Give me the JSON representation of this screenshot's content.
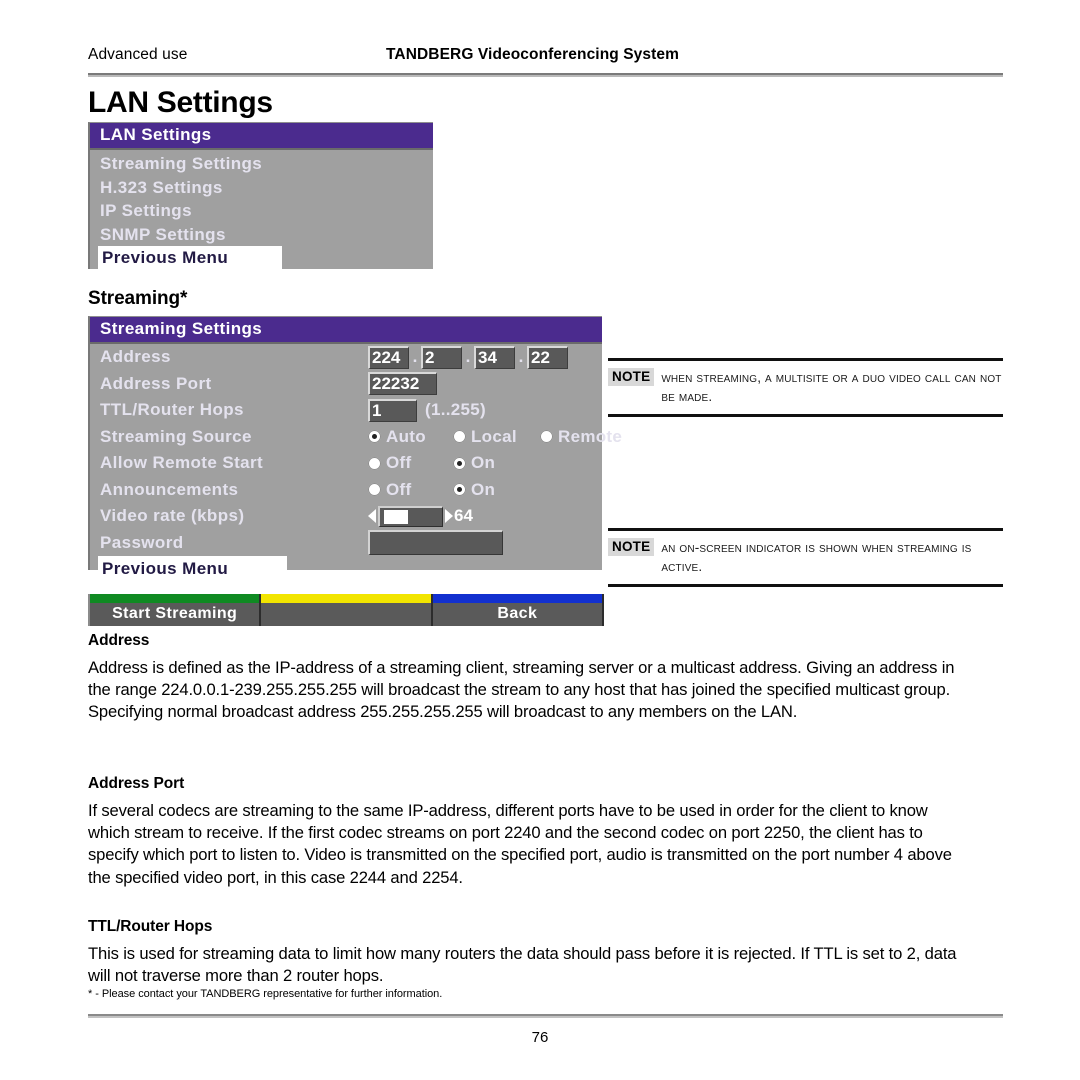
{
  "header": {
    "left": "Advanced use",
    "center": "TANDBERG Videoconferencing System"
  },
  "page_title": "LAN Settings",
  "lan_menu": {
    "title": "LAN Settings",
    "items": [
      "Streaming Settings",
      "H.323 Settings",
      "IP Settings",
      "SNMP Settings"
    ],
    "selected_item": "Previous Menu"
  },
  "sub_title": "Streaming*",
  "streaming_menu": {
    "title": "Streaming Settings",
    "address": {
      "label": "Address",
      "octets": [
        "224",
        "2",
        "34",
        "22"
      ],
      "separator": "."
    },
    "address_port": {
      "label": "Address Port",
      "value": "22232"
    },
    "ttl": {
      "label": "TTL/Router Hops",
      "value": "1",
      "range_hint": "(1..255)"
    },
    "streaming_source": {
      "label": "Streaming Source",
      "options": [
        "Auto",
        "Local",
        "Remote"
      ],
      "selected": "Auto"
    },
    "allow_remote_start": {
      "label": "Allow Remote Start",
      "options": [
        "Off",
        "On"
      ],
      "selected": "On"
    },
    "announcements": {
      "label": "Announcements",
      "options": [
        "Off",
        "On"
      ],
      "selected": "On"
    },
    "video_rate": {
      "label": "Video rate (kbps)",
      "value": "64",
      "thumb_percent": 8
    },
    "password": {
      "label": "Password",
      "value": ""
    },
    "selected_item": "Previous Menu"
  },
  "softkeys": [
    {
      "label": "Start Streaming",
      "color": "#0f8a22"
    },
    {
      "label": "",
      "color": "#f2e500"
    },
    {
      "label": "Back",
      "color": "#1230cf"
    }
  ],
  "notes": [
    {
      "tag": "NOTE",
      "text": "When streaming, a MultiSite or a Duo Video call can not be made."
    },
    {
      "tag": "NOTE",
      "text": "An on-screen indicator is shown when streaming is active."
    }
  ],
  "sections": [
    {
      "heading": "Address",
      "body": "Address is defined as the IP-address of a streaming client, streaming server or a multicast address. Giving an address in the range 224.0.0.1-239.255.255.255 will broadcast the stream to any host that has joined the specified multicast group. Specifying normal broadcast address 255.255.255.255 will broadcast to any members on the LAN."
    },
    {
      "heading": "Address Port",
      "body": "If several codecs are streaming to the same IP-address, different ports have to be used in order for the client to know which stream to receive. If the first codec streams on port 2240 and the second codec on port 2250, the client has to specify which port to listen to. Video is transmitted on the specified port, audio is transmitted on the port number 4 above the specified video port, in this case 2244 and 2254."
    },
    {
      "heading": "TTL/Router Hops",
      "body": "This is used for streaming data to limit how many routers the data should pass before it is rejected.  If TTL is set to 2, data will not traverse more than 2 router hops."
    }
  ],
  "footnote": "* - Please contact your TANDBERG representative for further information.",
  "page_number": "76"
}
